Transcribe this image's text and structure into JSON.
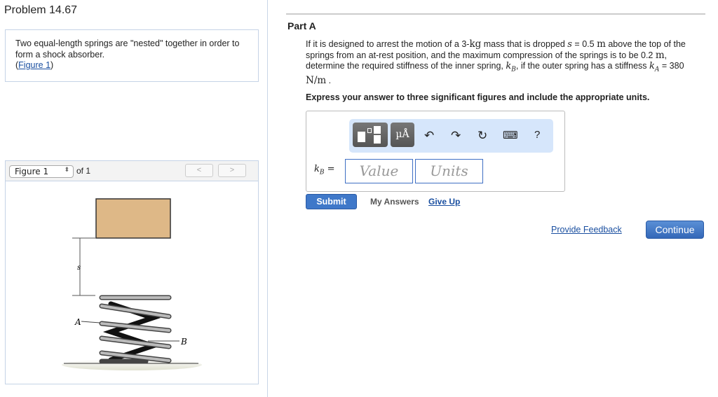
{
  "problem": {
    "title": "Problem 14.67",
    "description": "Two equal-length springs are \"nested\" together in order to form a shock absorber.",
    "figure_link_open": "(",
    "figure_link": "Figure 1",
    "figure_link_close": ")"
  },
  "figure": {
    "select_value": "Figure 1",
    "of_label": "of 1",
    "prev": "<",
    "next": ">",
    "labels": {
      "s": "s",
      "A": "A",
      "B": "B"
    }
  },
  "part": {
    "title": "Part A",
    "question": {
      "t1": "If it is designed to arrest the motion of a 3-",
      "kg": "kg",
      "t2": " mass that is dropped ",
      "s": "s",
      "t3": " = 0.5 ",
      "m1": "m",
      "t4": " above the top of the springs from an at-rest position, and the maximum compression of the springs is to be 0.2 ",
      "m2": "m",
      "t5": ", determine the required stiffness of the inner spring, ",
      "kB": "kB",
      "t6": ", if the outer spring has a stiffness ",
      "kA": "kA",
      "t7": " = 380 ",
      "unit": "N/m",
      "t8": " ."
    },
    "instruction": "Express your answer to three significant figures and include the appropriate units."
  },
  "answer": {
    "label": "kB =",
    "value_placeholder": "Value",
    "units_placeholder": "Units",
    "toolbar": {
      "units_button": "µÅ",
      "help": "?"
    }
  },
  "actions": {
    "submit": "Submit",
    "my_answers": "My Answers",
    "give_up": "Give Up",
    "feedback": "Provide Feedback",
    "continue": "Continue"
  }
}
